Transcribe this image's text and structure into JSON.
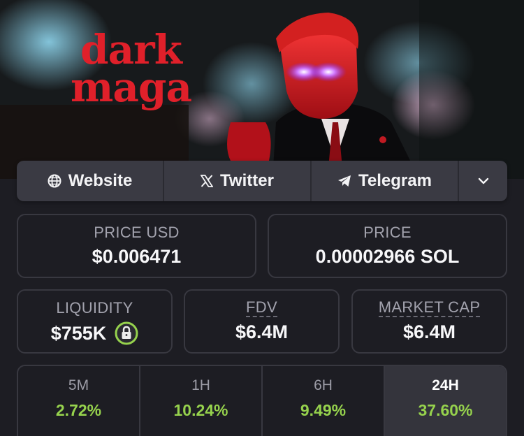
{
  "banner": {
    "logo_line1": "dark",
    "logo_line2": "maga"
  },
  "links": {
    "website": {
      "label": "Website",
      "icon": "globe-icon"
    },
    "twitter": {
      "label": "Twitter",
      "icon": "x-logo-icon"
    },
    "telegram": {
      "label": "Telegram",
      "icon": "telegram-icon"
    },
    "more": {
      "icon": "chevron-down-icon"
    }
  },
  "stats": {
    "price_usd": {
      "label": "PRICE USD",
      "value": "$0.006471"
    },
    "price_native": {
      "label": "PRICE",
      "value": "0.00002966 SOL"
    },
    "liquidity": {
      "label": "LIQUIDITY",
      "value": "$755K",
      "icon": "lock-icon"
    },
    "fdv": {
      "label": "FDV",
      "value": "$6.4M"
    },
    "market_cap": {
      "label": "MARKET CAP",
      "value": "$6.4M"
    }
  },
  "changes": [
    {
      "label": "5M",
      "value": "2.72%"
    },
    {
      "label": "1H",
      "value": "10.24%"
    },
    {
      "label": "6H",
      "value": "9.49%"
    },
    {
      "label": "24H",
      "value": "37.60%",
      "active": true
    }
  ],
  "colors": {
    "positive": "#96d24d",
    "accent_red": "#e0202a",
    "eyes": "#c050ff"
  }
}
